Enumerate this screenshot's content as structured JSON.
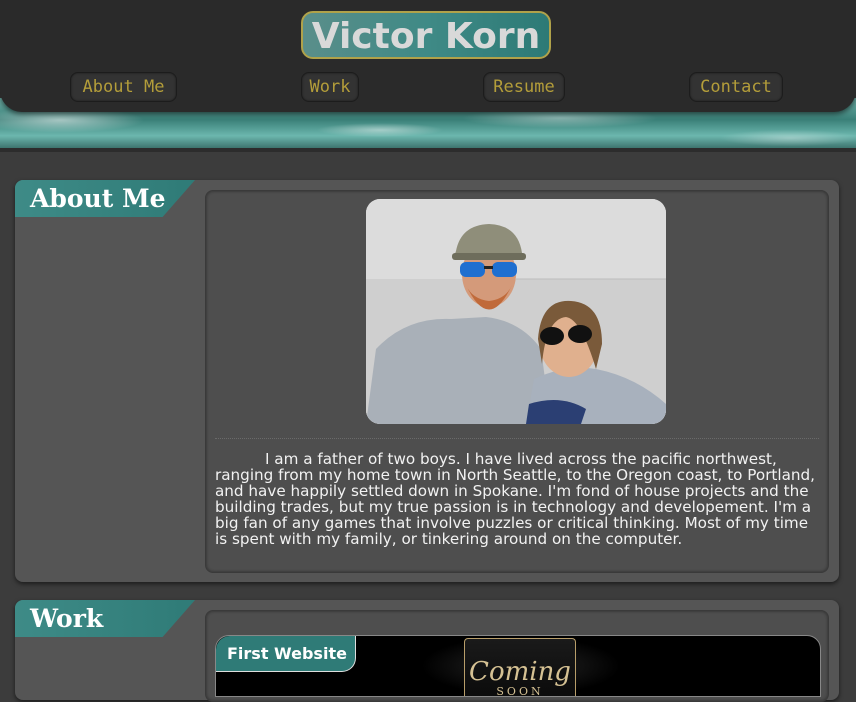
{
  "header": {
    "site_title": "Victor Korn",
    "nav": [
      {
        "label": "About Me"
      },
      {
        "label": "Work"
      },
      {
        "label": "Resume"
      },
      {
        "label": "Contact"
      }
    ]
  },
  "about": {
    "heading": "About Me",
    "photo_alt": "photo-of-victor-and-partner",
    "bio": "I am a father of two boys. I have lived across the pacific northwest, ranging from my home town in North Seattle, to the Oregon coast, to Portland, and have happily settled down in Spokane. I'm fond of house projects and the building trades, but my true passion is in technology and developement. I'm a big fan of any games that involve puzzles or critical thinking. Most of my time is spent with my family, or tinkering around on the computer."
  },
  "work": {
    "heading": "Work",
    "projects": [
      {
        "title": "First Website",
        "preview_text": "Coming",
        "preview_subtext": "SOON"
      }
    ]
  },
  "colors": {
    "accent_teal": "#2f7b77",
    "nav_text_gold": "#b39d3a",
    "title_border_gold": "#b0a24a",
    "background": "#3c3c3c",
    "panel": "#555555"
  }
}
